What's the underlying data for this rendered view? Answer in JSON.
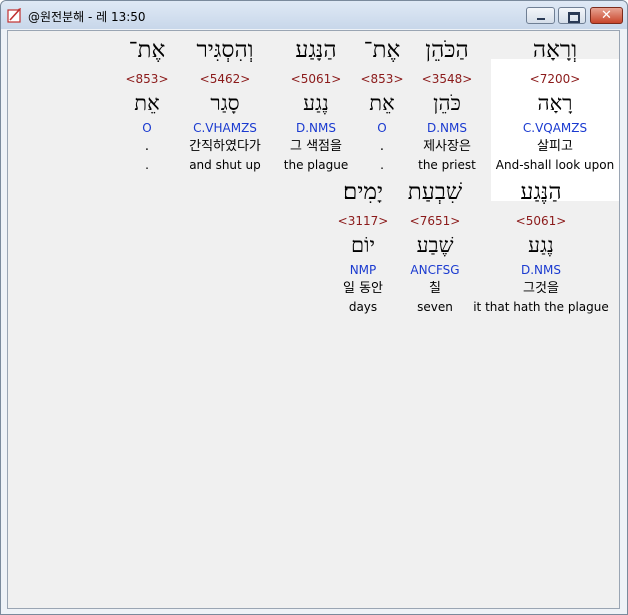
{
  "window": {
    "title": "@원전분해 - 레 13:50",
    "close_label": "✕"
  },
  "verse": {
    "line1": [
      {
        "hebrew": "וְרָאָה",
        "strong": "<7200>",
        "lemma": "רָאָה",
        "parse": "C.VQAMZS",
        "korean": "살피고",
        "english": "And-shall look upon"
      },
      {
        "hebrew": "הַכֹּהֵן",
        "strong": "<3548>",
        "lemma": "כֹּהֵן",
        "parse": "D.NMS",
        "korean": "제사장은",
        "english": "the priest"
      },
      {
        "hebrew": "אֶת־",
        "strong": "<853>",
        "lemma": "אֵת",
        "parse": "O",
        "korean": ".",
        "english": "."
      },
      {
        "hebrew": "הַנָּגַע",
        "strong": "<5061>",
        "lemma": "נֶגַע",
        "parse": "D.NMS",
        "korean": "그 색점을",
        "english": "the plague"
      },
      {
        "hebrew": "וְהִסְגִּיר",
        "strong": "<5462>",
        "lemma": "סָגַר",
        "parse": "C.VHAMZS",
        "korean": "간직하였다가",
        "english": "and shut up"
      },
      {
        "hebrew": "אֶת־",
        "strong": "<853>",
        "lemma": "אֵת",
        "parse": "O",
        "korean": ".",
        "english": "."
      }
    ],
    "line2": [
      {
        "hebrew": "הַנֶּגַע",
        "strong": "<5061>",
        "lemma": "נֶגַע",
        "parse": "D.NMS",
        "korean": "그것을",
        "english": "it that hath the plague"
      },
      {
        "hebrew": "שִׁבְעַת",
        "strong": "<7651>",
        "lemma": "שֶׁבַע",
        "parse": "ANCFSG",
        "korean": "칠",
        "english": "seven"
      },
      {
        "hebrew": "יָמִים׃",
        "strong": "<3117>",
        "lemma": "יוֹם",
        "parse": "NMP",
        "korean": "일 동안",
        "english": "days"
      }
    ]
  },
  "colors": {
    "strong": "#8b1a1a",
    "parse": "#1a3ad0",
    "highlight": "#ffffff"
  }
}
